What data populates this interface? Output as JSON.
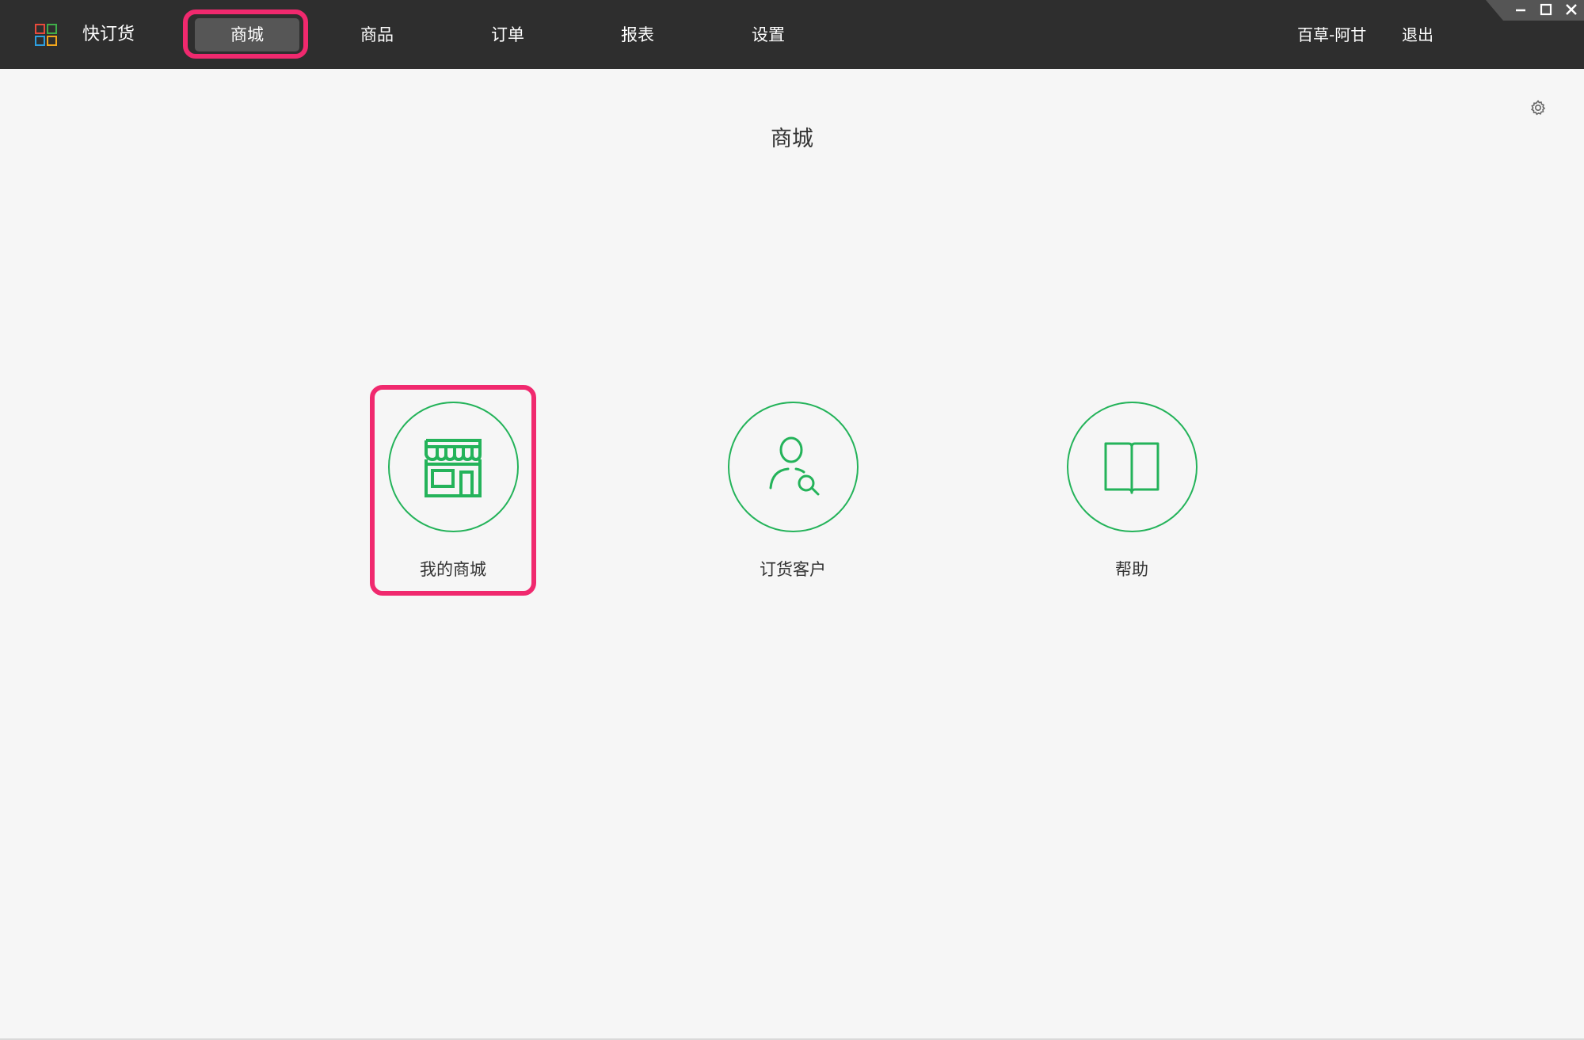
{
  "app": {
    "name": "快订货",
    "logo_icon": "app-grid-logo"
  },
  "nav": {
    "items": [
      {
        "label": "商城",
        "active": true
      },
      {
        "label": "商品",
        "active": false
      },
      {
        "label": "订单",
        "active": false
      },
      {
        "label": "报表",
        "active": false
      },
      {
        "label": "设置",
        "active": false
      }
    ]
  },
  "header": {
    "user_name": "百草-阿甘",
    "logout_label": "退出"
  },
  "window_controls": {
    "minimize_icon": "minimize-icon",
    "maximize_icon": "maximize-icon",
    "close_icon": "close-icon"
  },
  "main": {
    "title": "商城",
    "settings_icon": "gear-icon",
    "tiles": [
      {
        "label": "我的商城",
        "icon": "storefront-icon"
      },
      {
        "label": "订货客户",
        "icon": "user-search-icon"
      },
      {
        "label": "帮助",
        "icon": "open-book-icon"
      }
    ]
  },
  "colors": {
    "topbar_bg": "#2e2e2e",
    "active_tab_bg": "#565656",
    "accent_green": "#24b35a",
    "highlight_pink": "#f0296e",
    "page_bg": "#f6f6f6"
  }
}
